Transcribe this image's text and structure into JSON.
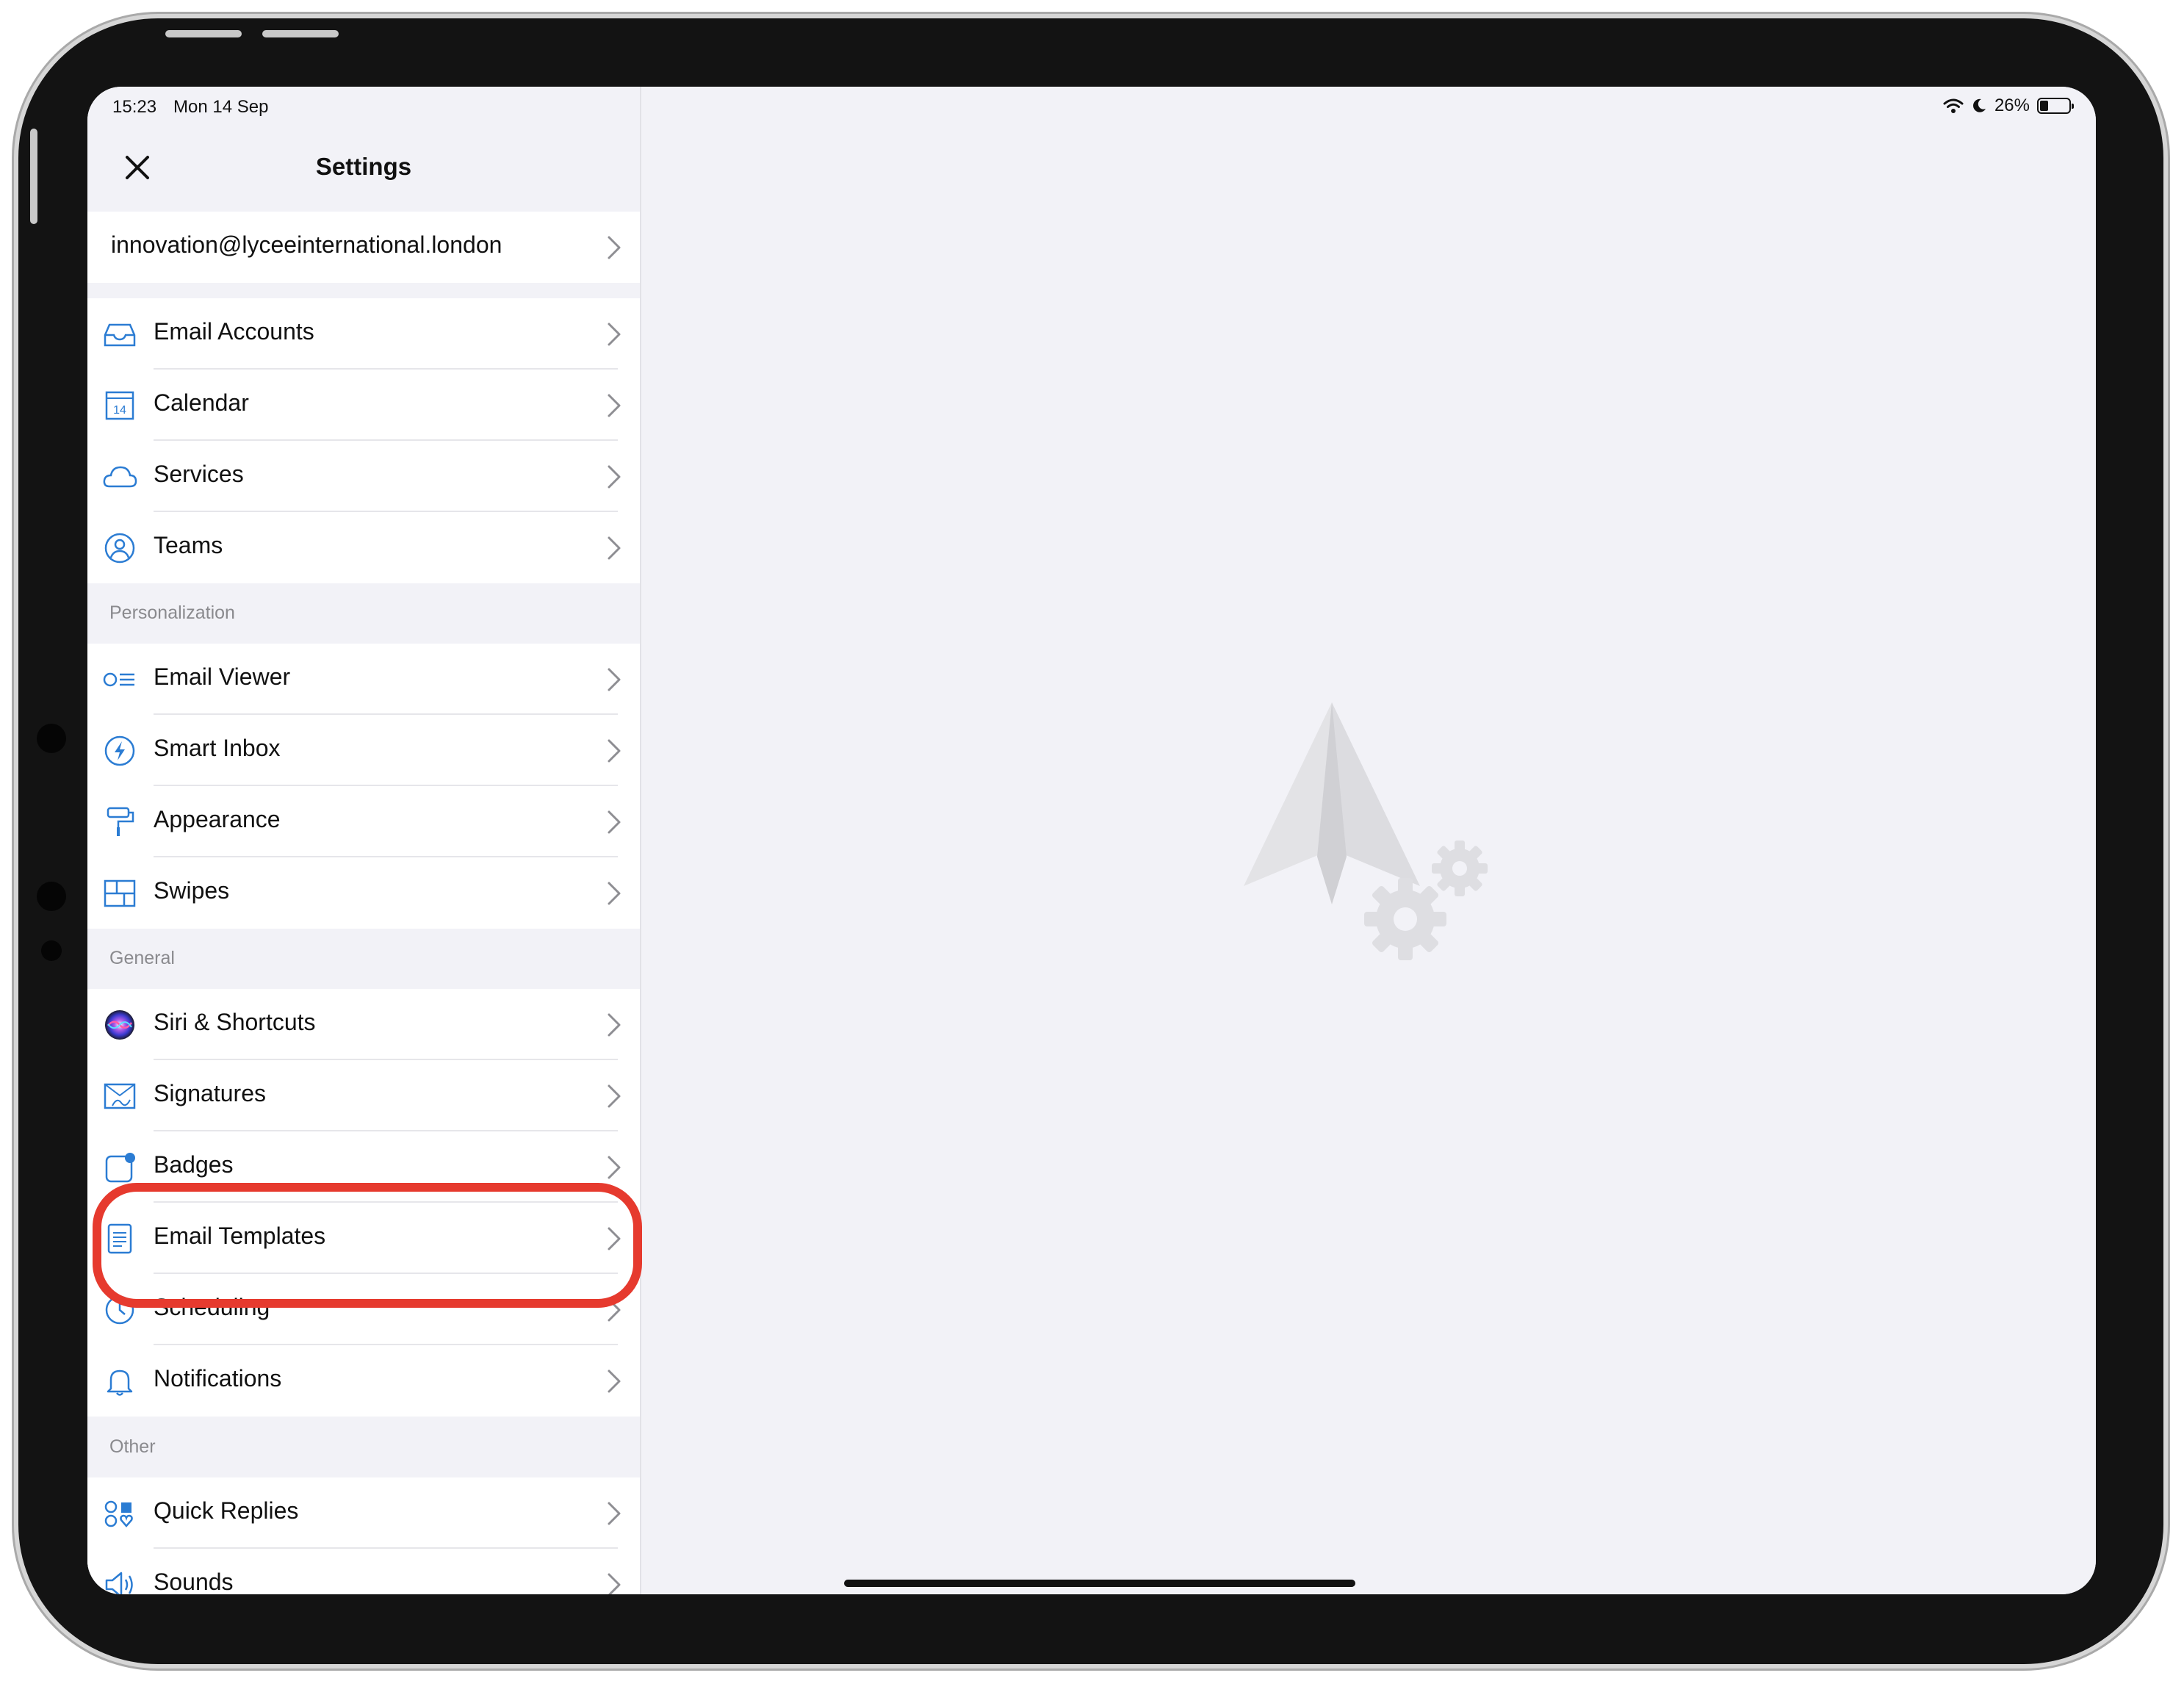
{
  "status_bar": {
    "time": "15:23",
    "date": "Mon 14 Sep",
    "battery": "26%",
    "battery_level": 0.26
  },
  "nav": {
    "title": "Settings"
  },
  "account": {
    "email": "innovation@lyceeinternational.london"
  },
  "sections": {
    "accounts": [
      {
        "label": "Email Accounts",
        "icon": "inbox-tray-icon"
      },
      {
        "label": "Calendar",
        "icon": "calendar-icon",
        "icon_text": "14"
      },
      {
        "label": "Services",
        "icon": "cloud-icon"
      },
      {
        "label": "Teams",
        "icon": "person-circle-icon"
      }
    ],
    "personalization_header": "Personalization",
    "personalization": [
      {
        "label": "Email Viewer",
        "icon": "list-icon"
      },
      {
        "label": "Smart Inbox",
        "icon": "bolt-icon"
      },
      {
        "label": "Appearance",
        "icon": "paint-roller-icon"
      },
      {
        "label": "Swipes",
        "icon": "swipes-icon"
      }
    ],
    "general_header": "General",
    "general": [
      {
        "label": "Siri & Shortcuts",
        "icon": "siri-icon"
      },
      {
        "label": "Signatures",
        "icon": "signature-icon"
      },
      {
        "label": "Badges",
        "icon": "badge-icon"
      },
      {
        "label": "Email Templates",
        "icon": "document-icon"
      },
      {
        "label": "Scheduling",
        "icon": "clock-icon"
      },
      {
        "label": "Notifications",
        "icon": "bell-icon"
      }
    ],
    "other_header": "Other",
    "other": [
      {
        "label": "Quick Replies",
        "icon": "quick-replies-icon"
      },
      {
        "label": "Sounds",
        "icon": "speaker-icon"
      }
    ]
  },
  "colors": {
    "accent": "#2b7cd3",
    "highlight": "#e63a2e",
    "background": "#f2f2f7"
  }
}
